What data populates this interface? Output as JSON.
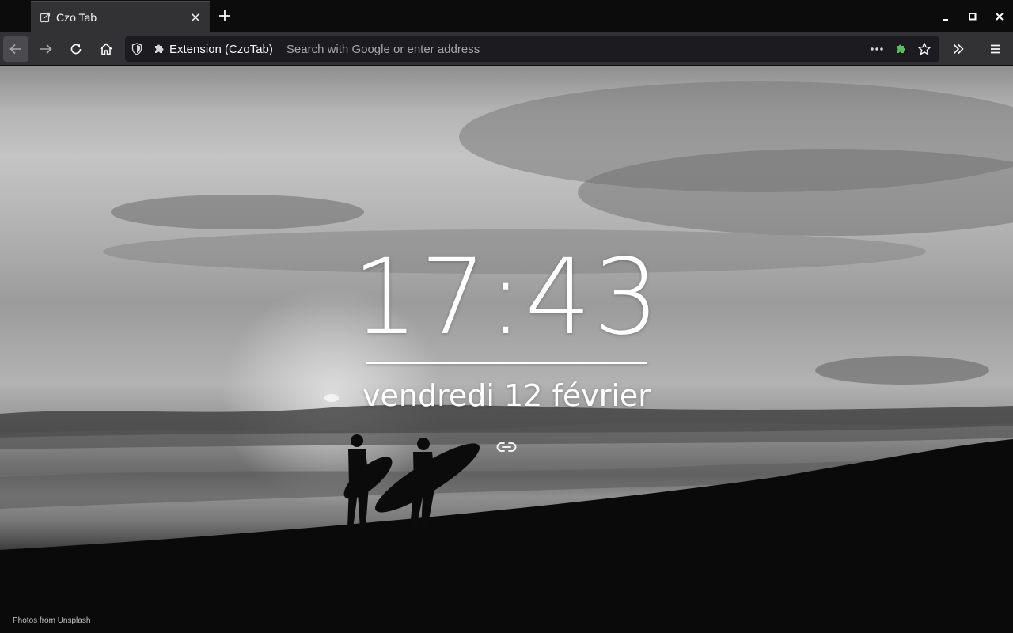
{
  "tab": {
    "title": "Czo Tab",
    "favicon": "external-link-icon"
  },
  "window_controls": [
    "minimize-icon",
    "maximize-icon",
    "close-icon"
  ],
  "navbar": {
    "identity_label": "Extension (CzoTab)",
    "url_value": "",
    "url_placeholder": "Search with Google or enter address",
    "extension_icon_color": "#3fe1b0"
  },
  "page": {
    "time": "17:43",
    "date": "vendredi 12 février",
    "credit": "Photos from Unsplash"
  },
  "colors": {
    "chrome_dark": "#0c0c0d",
    "toolbar": "#323234",
    "urlbar": "#1c1b22",
    "text": "#f9f9fa",
    "extension_green": "#57c25c"
  }
}
